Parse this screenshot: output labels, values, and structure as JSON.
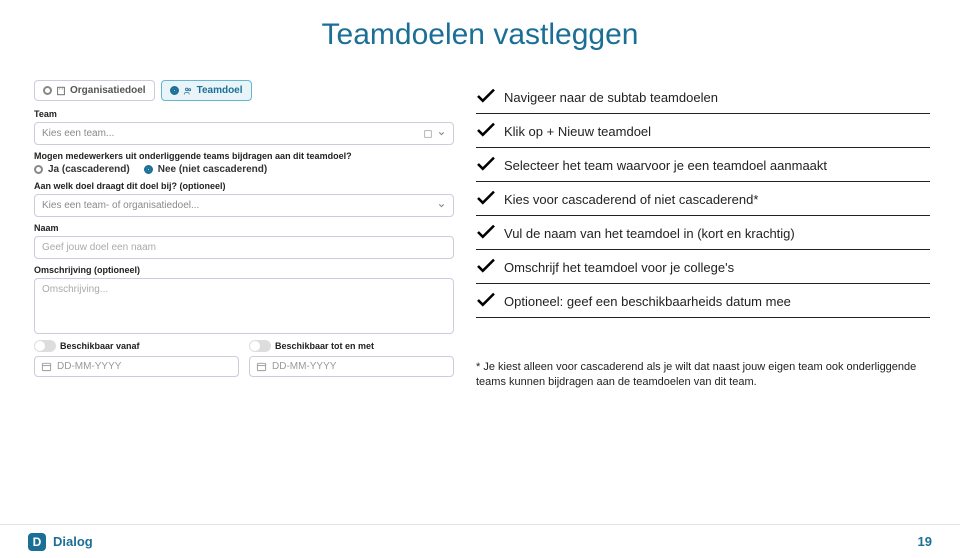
{
  "title": "Teamdoelen vastleggen",
  "screenshot": {
    "tab_org": "Organisatiedoel",
    "tab_team": "Teamdoel",
    "lbl_team": "Team",
    "select_team": "Kies een team...",
    "lbl_cascading": "Mogen medewerkers uit onderliggende teams bijdragen aan dit teamdoel?",
    "radio_yes": "Ja (cascaderend)",
    "radio_no": "Nee (niet cascaderend)",
    "lbl_contributes": "Aan welk doel draagt dit doel bij? (optioneel)",
    "select_contributes": "Kies een team- of organisatiedoel...",
    "lbl_name": "Naam",
    "input_name": "Geef jouw doel een naam",
    "lbl_desc": "Omschrijving (optioneel)",
    "input_desc": "Omschrijving...",
    "lbl_from": "Beschikbaar vanaf",
    "lbl_to": "Beschikbaar tot en met",
    "date_ph": "DD-MM-YYYY"
  },
  "checklist": [
    "Navigeer naar de subtab teamdoelen",
    "Klik op + Nieuw teamdoel",
    "Selecteer het team waarvoor je een teamdoel aanmaakt",
    "Kies voor cascaderend of niet cascaderend*",
    "Vul de naam van het teamdoel in (kort en krachtig)",
    "Omschrijf het teamdoel voor je college's",
    "Optioneel: geef een beschikbaarheids datum mee"
  ],
  "footnote": "* Je kiest alleen voor cascaderend als je wilt dat naast jouw eigen team ook onderliggende teams kunnen bijdragen aan de teamdoelen van dit team.",
  "brand": "Dialog",
  "page_number": "19"
}
